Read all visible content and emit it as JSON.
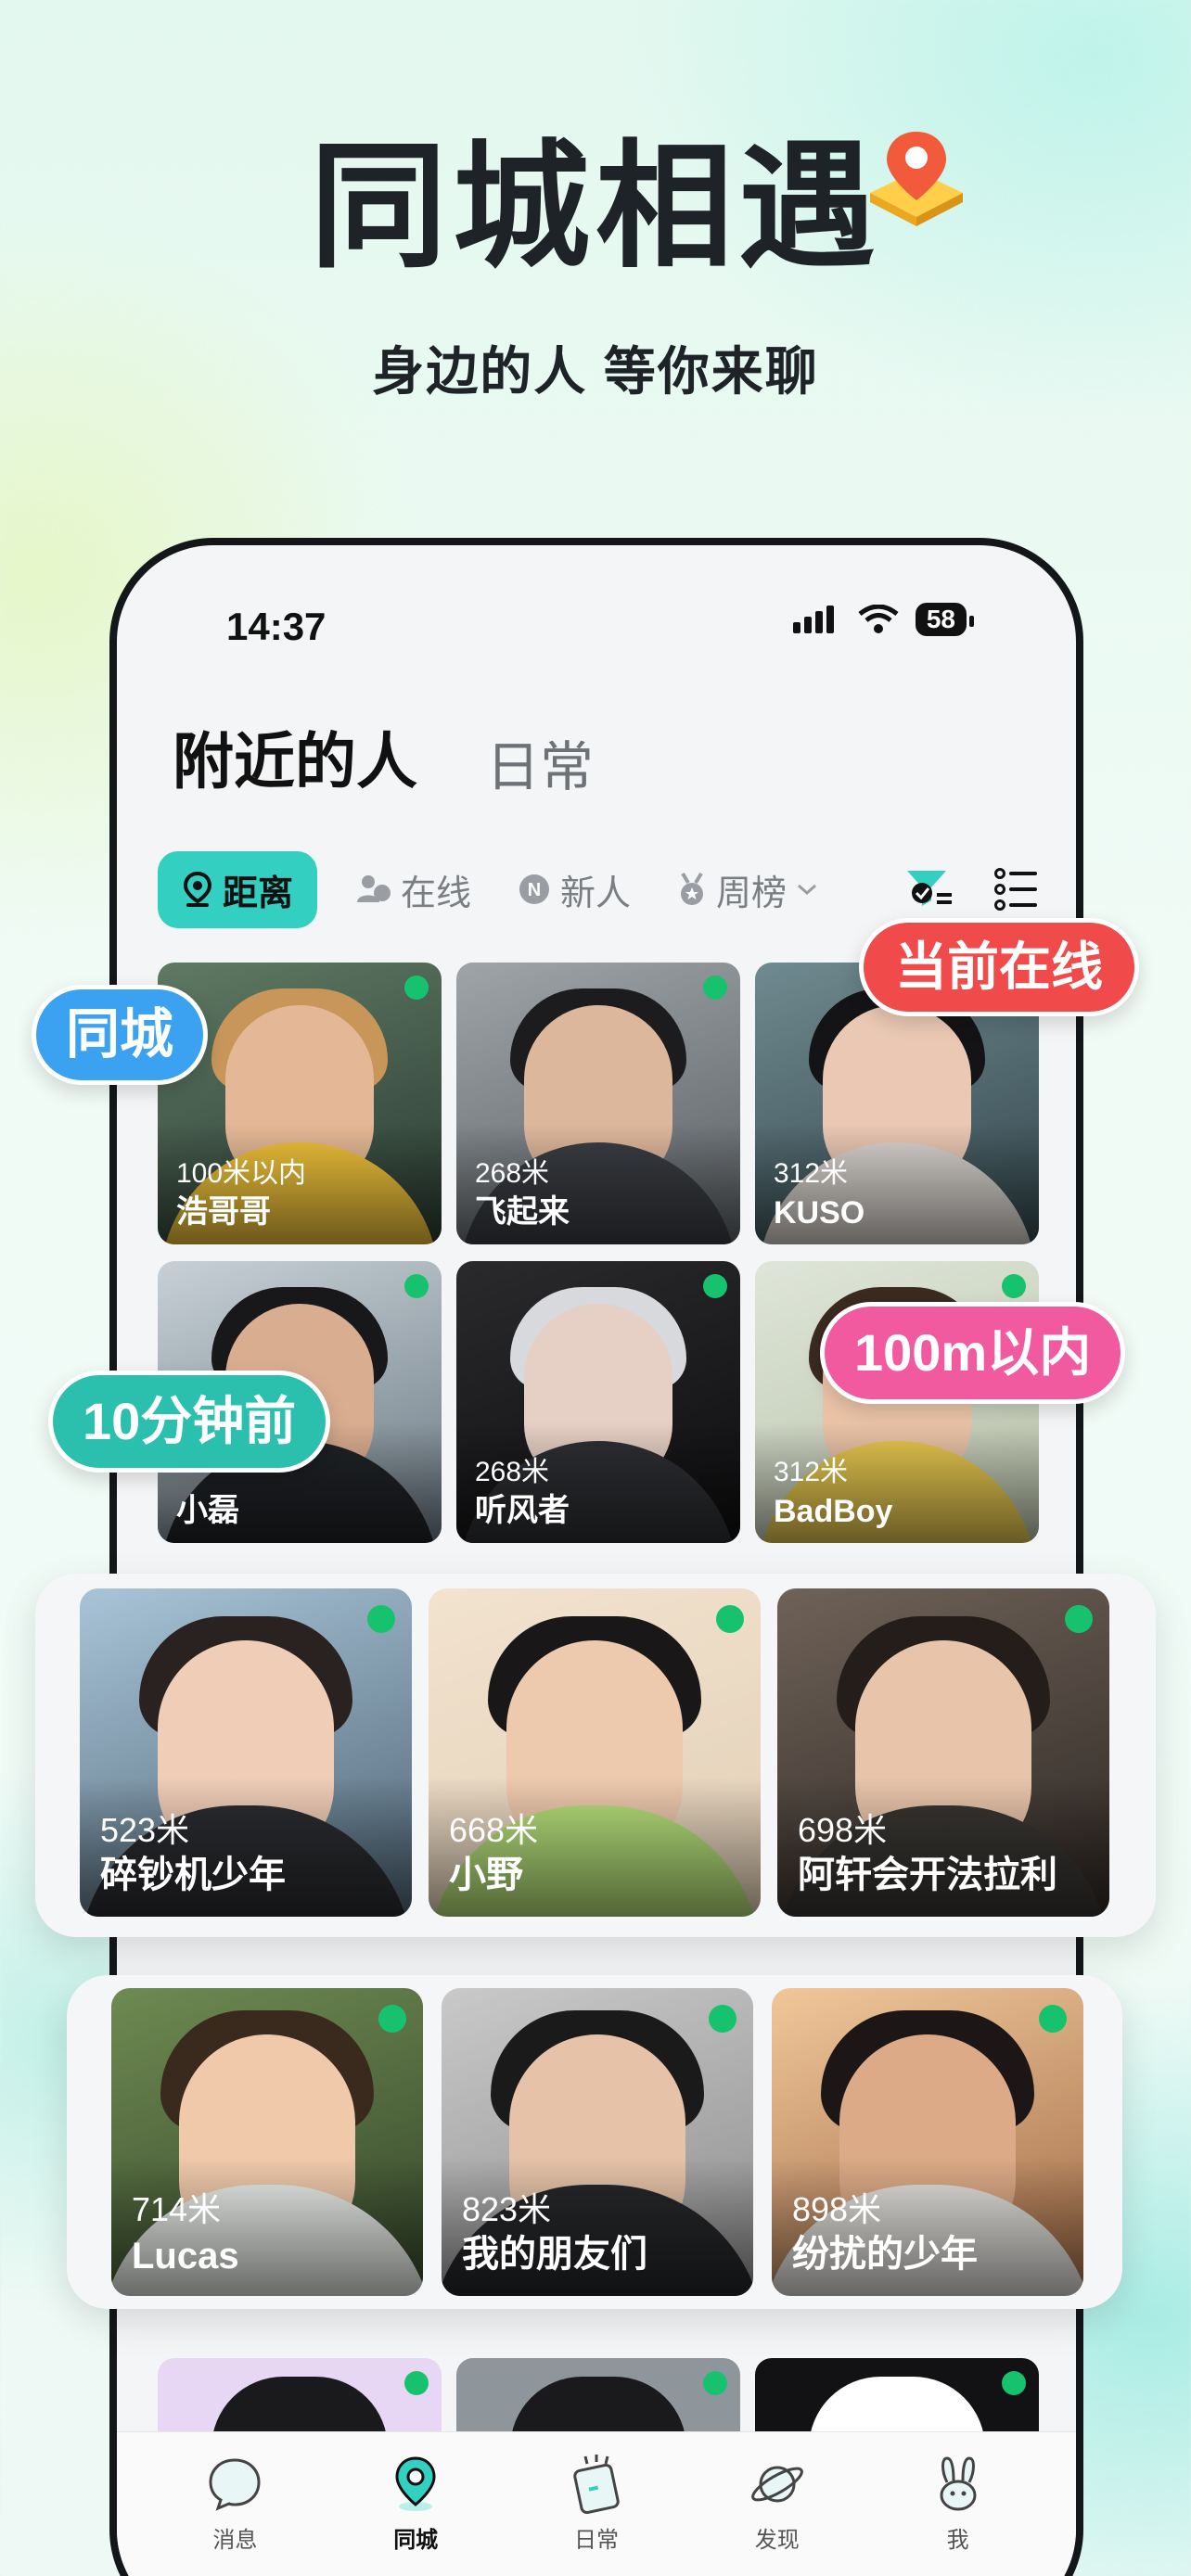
{
  "hero": {
    "title": "同城相遇",
    "subtitle": "身边的人 等你来聊"
  },
  "status_bar": {
    "time": "14:37",
    "battery": "58"
  },
  "tabs": {
    "active": "附近的人",
    "other": "日常"
  },
  "filters": {
    "distance": "距离",
    "online": "在线",
    "newcomer": "新人",
    "weekly": "周榜"
  },
  "colors": {
    "accent": "#33cfc0",
    "online_dot": "#17c26e",
    "bubble_blue": "#3aa2f0",
    "bubble_red": "#f04a4a",
    "bubble_teal": "#2bbfae",
    "bubble_pink": "#f25aa0"
  },
  "users": [
    {
      "dist": "100米以内",
      "name": "浩哥哥"
    },
    {
      "dist": "268米",
      "name": "飞起来"
    },
    {
      "dist": "312米",
      "name": "KUSO"
    },
    {
      "dist": "",
      "name": "小磊"
    },
    {
      "dist": "268米",
      "name": "听风者"
    },
    {
      "dist": "312米",
      "name": "BadBoy"
    },
    {
      "dist": "523米",
      "name": "碎钞机少年"
    },
    {
      "dist": "668米",
      "name": "小野"
    },
    {
      "dist": "698米",
      "name": "阿轩会开法拉利"
    },
    {
      "dist": "714米",
      "name": "Lucas"
    },
    {
      "dist": "823米",
      "name": "我的朋友们"
    },
    {
      "dist": "898米",
      "name": "纷扰的少年"
    }
  ],
  "bubbles": {
    "same_city": "同城",
    "online_now": "当前在线",
    "ten_min": "10分钟前",
    "within_100m": "100m以内"
  },
  "tabbar": {
    "messages": "消息",
    "nearby": "同城",
    "daily": "日常",
    "discover": "发现",
    "me": "我"
  }
}
